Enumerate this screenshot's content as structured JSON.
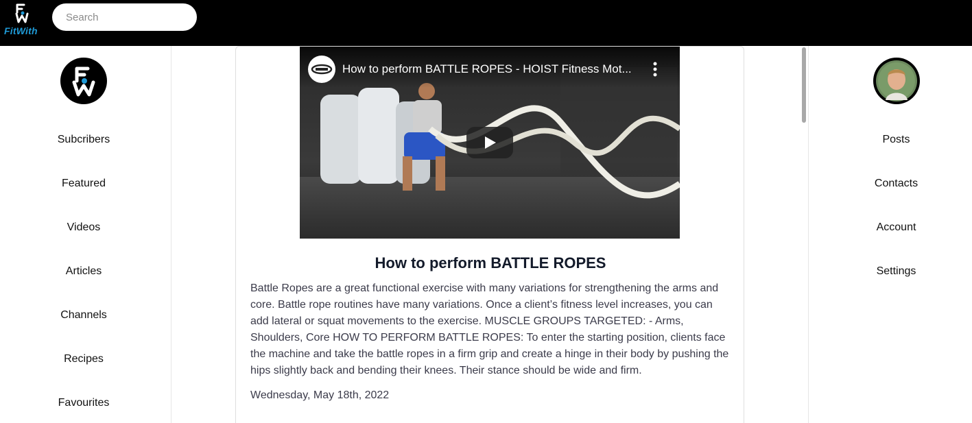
{
  "header": {
    "brand_name": "FitWith",
    "search_placeholder": "Search"
  },
  "left_nav": {
    "items": [
      "Subcribers",
      "Featured",
      "Videos",
      "Articles",
      "Channels",
      "Recipes",
      "Favourites"
    ]
  },
  "right_nav": {
    "items": [
      "Posts",
      "Contacts",
      "Account",
      "Settings"
    ]
  },
  "post": {
    "video_title": "How to perform BATTLE ROPES - HOIST Fitness Mot...",
    "title": "How to perform BATTLE ROPES",
    "body": "Battle Ropes are a great functional exercise with many variations for strengthening the arms and core. Battle rope routines have many variations. Once a client’s fitness level increases, you can add lateral or squat movements to the exercise. MUSCLE GROUPS TARGETED: - Arms, Shoulders, Core HOW TO PERFORM BATTLE ROPES: To enter the starting position, clients face the machine and take the battle ropes in a firm grip and create a hinge in their body by pushing the hips slightly back and bending their knees. Their stance should be wide and firm.",
    "date": "Wednesday, May 18th, 2022"
  },
  "icons": {
    "brand": "fitwith-logo-icon",
    "channel": "hoist-channel-icon",
    "menu": "more-vert-icon",
    "play": "play-icon",
    "avatar": "user-avatar"
  },
  "colors": {
    "topbar": "#000000",
    "brand_accent": "#1f9ad6",
    "text": "#3b3b4a",
    "title": "#131a2a"
  }
}
